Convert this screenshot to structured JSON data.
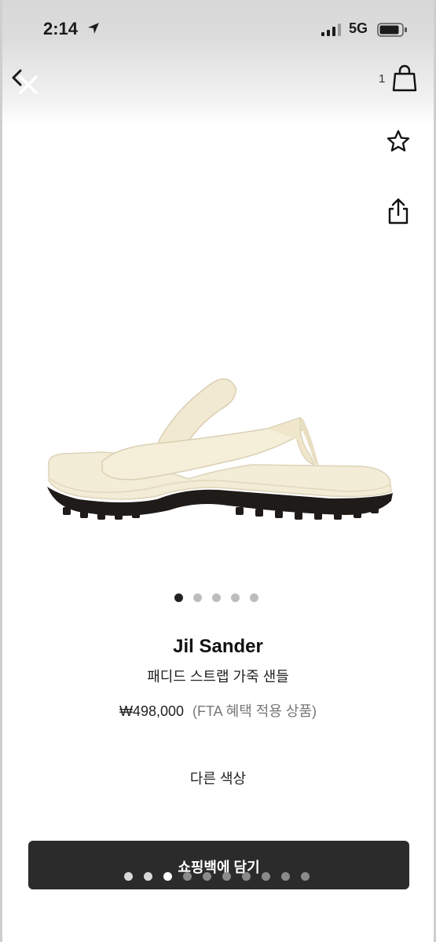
{
  "status_bar": {
    "time": "2:14",
    "network": "5G"
  },
  "header": {
    "bag_count": "1"
  },
  "carousel": {
    "dot_count": 5,
    "active_index": 0
  },
  "product": {
    "brand": "Jil Sander",
    "name": "패디드 스트랩 가죽 샌들",
    "price": "₩498,000",
    "price_note": "(FTA 혜택 적용 상품)",
    "other_colors_label": "다른 색상"
  },
  "cart_button": {
    "label": "쇼핑백에 담기"
  },
  "page_indicator": {
    "dot_count": 10,
    "active_index": 2
  },
  "colors": {
    "button_bg": "#2b2b2b",
    "sandal_cream": "#f3ecd6",
    "sole": "#1f1b18"
  }
}
